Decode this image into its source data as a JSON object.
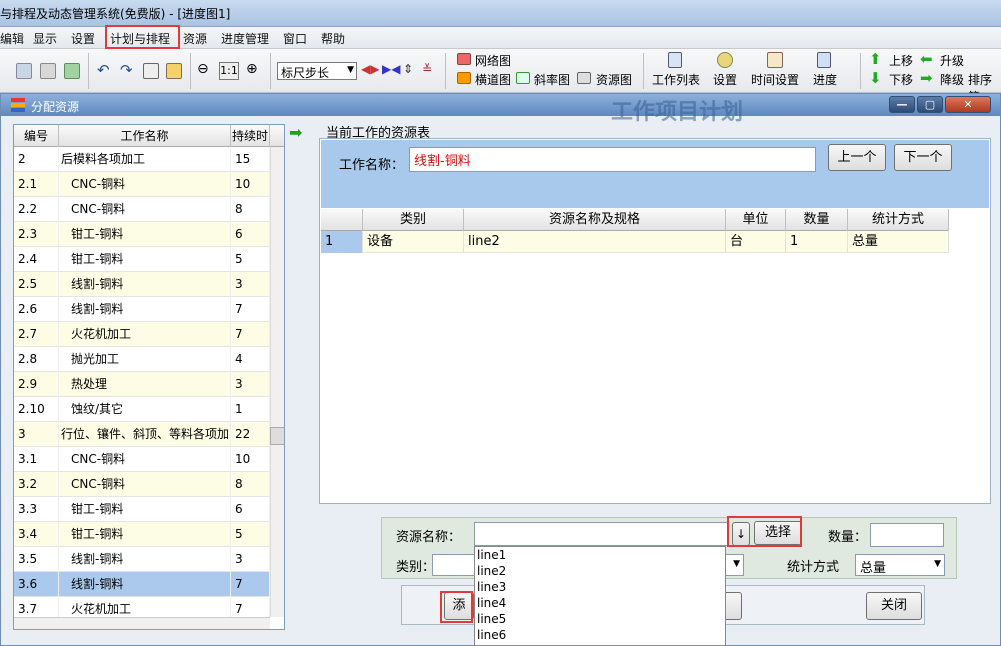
{
  "app": {
    "title": "与排程及动态管理系统(免费版) - [进度图1]"
  },
  "menu": [
    "编辑",
    "显示",
    "设置",
    "计划与排程",
    "资源",
    "进度管理",
    "窗口",
    "帮助"
  ],
  "toolbar": {
    "zoom_label": "1:1",
    "ruler_select": "标尺步长",
    "view_buttons": [
      "网络图",
      "横道图",
      "斜率图",
      "资源图"
    ],
    "big_buttons": [
      "工作列表",
      "设置",
      "时间设置",
      "进度"
    ],
    "move_buttons": [
      "上移",
      "下移",
      "升级",
      "降级",
      "排序筛"
    ]
  },
  "dialog": {
    "title": "分配资源",
    "bg_text": "工作项目计划",
    "left_table": {
      "columns": [
        "编号",
        "工作名称",
        "持续时"
      ],
      "rows": [
        {
          "id": "2",
          "name": "后模料各项加工",
          "dur": "15"
        },
        {
          "id": "2.1",
          "name": "CNC-铜料",
          "dur": "10"
        },
        {
          "id": "2.2",
          "name": "CNC-铜料",
          "dur": "8"
        },
        {
          "id": "2.3",
          "name": "钳工-铜料",
          "dur": "6"
        },
        {
          "id": "2.4",
          "name": "钳工-铜料",
          "dur": "5"
        },
        {
          "id": "2.5",
          "name": "线割-铜料",
          "dur": "3"
        },
        {
          "id": "2.6",
          "name": "线割-铜料",
          "dur": "7"
        },
        {
          "id": "2.7",
          "name": "火花机加工",
          "dur": "7"
        },
        {
          "id": "2.8",
          "name": "抛光加工",
          "dur": "4"
        },
        {
          "id": "2.9",
          "name": "热处理",
          "dur": "3"
        },
        {
          "id": "2.10",
          "name": "蚀纹/其它",
          "dur": "1"
        },
        {
          "id": "3",
          "name": "行位、镶件、斜顶、等料各项加",
          "dur": "22"
        },
        {
          "id": "3.1",
          "name": "CNC-铜料",
          "dur": "10"
        },
        {
          "id": "3.2",
          "name": "CNC-铜料",
          "dur": "8"
        },
        {
          "id": "3.3",
          "name": "钳工-铜料",
          "dur": "6"
        },
        {
          "id": "3.4",
          "name": "钳工-铜料",
          "dur": "5"
        },
        {
          "id": "3.5",
          "name": "线割-铜料",
          "dur": "3"
        },
        {
          "id": "3.6",
          "name": "线割-铜料",
          "dur": "7"
        },
        {
          "id": "3.7",
          "name": "火花机加工",
          "dur": "7"
        }
      ]
    },
    "right": {
      "section_label": "当前工作的资源表",
      "work_name_label": "工作名称：",
      "work_name_value": "线割-铜料",
      "prev_button": "上一个",
      "next_button": "下一个",
      "grid_columns": [
        "类别",
        "资源名称及规格",
        "单位",
        "数量",
        "统计方式"
      ],
      "grid_rows": [
        {
          "no": "1",
          "category": "设备",
          "name": "line2",
          "unit": "台",
          "qty": "1",
          "stat": "总量"
        }
      ]
    },
    "lower": {
      "resource_name_label": "资源名称：",
      "resource_name_value": "",
      "dropdown_arrow": "↓",
      "select_button": "选择",
      "qty_label": "数量：",
      "category_label": "类别：",
      "stat_label": "统计方式",
      "stat_value": "总量",
      "add_button": "添",
      "close_button": "关闭",
      "dropdown_options": [
        "line1",
        "line2",
        "line3",
        "line4",
        "line5",
        "line6"
      ]
    }
  },
  "colors": {
    "accent_red": "#e23a3a",
    "selection_blue": "#aac9ed",
    "odd_row": "#fdfde6",
    "work_name_red": "#d01010"
  }
}
